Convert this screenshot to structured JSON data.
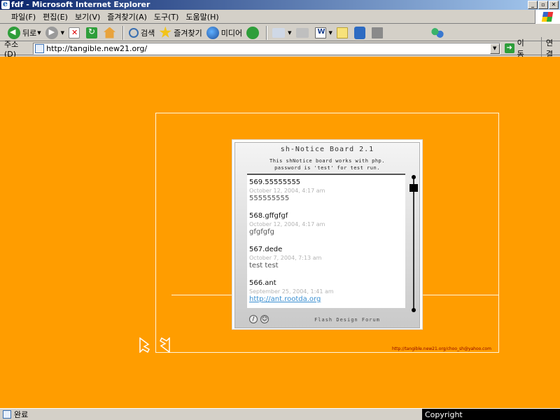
{
  "window": {
    "title": "fdf - Microsoft Internet Explorer"
  },
  "menu": [
    "파일(F)",
    "편집(E)",
    "보기(V)",
    "즐겨찾기(A)",
    "도구(T)",
    "도움말(H)"
  ],
  "toolbar": {
    "back": "뒤로",
    "search": "검색",
    "favorites": "즐겨찾기",
    "media": "미디어"
  },
  "address": {
    "label": "주소(D)",
    "url": "http://tangible.new21.org/",
    "go": "이동",
    "links": "연결"
  },
  "board": {
    "title": "sh-Notice Board 2.1",
    "subtitle_line1": "This shNotice board works with php.",
    "subtitle_line2": "password is 'test' for test run.",
    "footer": "Flash Design Forum",
    "posts": [
      {
        "title": "569.55555555",
        "date": "October 12, 2004, 4:17 am",
        "body": "555555555"
      },
      {
        "title": "568.gffgfgf",
        "date": "October 12, 2004, 4:17 am",
        "body": "gfgfgfg"
      },
      {
        "title": "567.dede",
        "date": "October 7, 2004, 7:13 am",
        "body": "test test"
      },
      {
        "title": "566.ant",
        "date": "September 25, 2004, 1:41 am",
        "body": "http://ant.rootda.org"
      }
    ]
  },
  "contact": "http://tangible.new21.org/choo_sh@yahoo.com",
  "status": {
    "text": "완료",
    "copyright": "Copyright   http://www.happycgi.com"
  },
  "colors": {
    "page_bg": "#ff9d00",
    "titlebar": "#0a246a",
    "link": "#3a8fd1"
  }
}
